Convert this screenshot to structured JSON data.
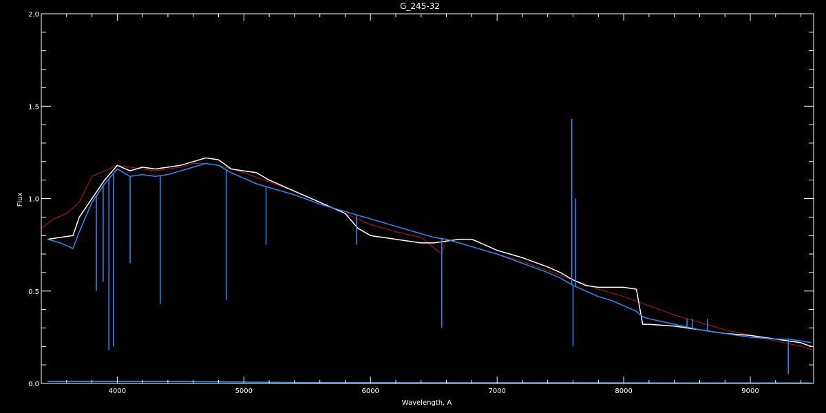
{
  "chart_data": {
    "type": "line",
    "title": "G_245-32",
    "xlabel": "Wavelength, A",
    "ylabel": "Flux",
    "xlim": [
      3400,
      9500
    ],
    "ylim": [
      0.0,
      2.0
    ],
    "x_ticks": [
      4000,
      5000,
      6000,
      7000,
      8000,
      9000
    ],
    "x_tick_labels": [
      "4000",
      "5000",
      "6000",
      "7000",
      "8000",
      "9000"
    ],
    "y_ticks": [
      0.0,
      0.5,
      1.0,
      1.5,
      2.0
    ],
    "y_tick_labels": [
      "0.0",
      "0.5",
      "1.0",
      "1.5",
      "2.0"
    ],
    "grid": false,
    "legend": "none",
    "colors": {
      "background": "#000000",
      "axes": "#ffffff",
      "observed": "#ffffff",
      "calibrated": "#1e90ff",
      "model": "#cc1111",
      "error": "#1e90ff"
    },
    "series": [
      {
        "color": "#cc1111",
        "x": [
          3400,
          3500,
          3600,
          3700,
          3800,
          3900,
          4000,
          4100,
          4200,
          4300,
          4400,
          4500,
          4600,
          4700,
          4800,
          4900,
          5000,
          5200,
          5400,
          5600,
          5800,
          6000,
          6200,
          6400,
          6562,
          6600,
          6800,
          7000,
          7200,
          7400,
          7600,
          7800,
          8000,
          8200,
          8400,
          8600,
          8800,
          9000,
          9200,
          9400,
          9500
        ],
        "y": [
          0.84,
          0.89,
          0.92,
          0.98,
          1.12,
          1.15,
          1.18,
          1.17,
          1.16,
          1.15,
          1.16,
          1.17,
          1.19,
          1.19,
          1.18,
          1.16,
          1.14,
          1.09,
          1.04,
          0.98,
          0.92,
          0.86,
          0.82,
          0.79,
          0.7,
          0.78,
          0.74,
          0.7,
          0.66,
          0.61,
          0.56,
          0.51,
          0.47,
          0.42,
          0.37,
          0.33,
          0.29,
          0.26,
          0.23,
          0.2,
          0.18
        ]
      },
      {
        "color": "#ffffff",
        "x": [
          3450,
          3550,
          3650,
          3700,
          3800,
          3900,
          4000,
          4100,
          4200,
          4300,
          4400,
          4500,
          4600,
          4700,
          4800,
          4900,
          5000,
          5100,
          5200,
          5400,
          5600,
          5800,
          5900,
          6000,
          6200,
          6400,
          6500,
          6600,
          6700,
          6800,
          6900,
          7000,
          7200,
          7400,
          7500,
          7600,
          7700,
          7800,
          7900,
          8000,
          8100,
          8150,
          8200,
          8400,
          8600,
          8800,
          9000,
          9200,
          9400,
          9480
        ],
        "y": [
          0.78,
          0.79,
          0.8,
          0.9,
          1.0,
          1.1,
          1.18,
          1.15,
          1.17,
          1.16,
          1.17,
          1.18,
          1.2,
          1.22,
          1.21,
          1.16,
          1.15,
          1.14,
          1.1,
          1.04,
          0.98,
          0.92,
          0.84,
          0.8,
          0.78,
          0.76,
          0.76,
          0.77,
          0.78,
          0.78,
          0.75,
          0.72,
          0.68,
          0.63,
          0.6,
          0.56,
          0.53,
          0.52,
          0.52,
          0.52,
          0.51,
          0.32,
          0.32,
          0.31,
          0.29,
          0.27,
          0.26,
          0.24,
          0.22,
          0.2
        ]
      },
      {
        "color": "#1e90ff",
        "x": [
          3450,
          3550,
          3650,
          3700,
          3800,
          3900,
          4000,
          4100,
          4200,
          4300,
          4400,
          4500,
          4600,
          4700,
          4800,
          4900,
          5000,
          5100,
          5200,
          5400,
          5600,
          5800,
          6000,
          6200,
          6400,
          6500,
          6600,
          6700,
          6800,
          6900,
          7000,
          7200,
          7400,
          7500,
          7600,
          7700,
          7800,
          7900,
          8000,
          8100,
          8150,
          8200,
          8400,
          8600,
          8800,
          9000,
          9200,
          9300,
          9400,
          9480
        ],
        "y": [
          0.78,
          0.76,
          0.73,
          0.82,
          0.98,
          1.08,
          1.16,
          1.12,
          1.13,
          1.12,
          1.13,
          1.15,
          1.17,
          1.19,
          1.18,
          1.14,
          1.11,
          1.08,
          1.06,
          1.02,
          0.97,
          0.93,
          0.89,
          0.85,
          0.81,
          0.79,
          0.78,
          0.76,
          0.74,
          0.72,
          0.7,
          0.65,
          0.6,
          0.57,
          0.53,
          0.5,
          0.47,
          0.45,
          0.42,
          0.39,
          0.36,
          0.35,
          0.32,
          0.29,
          0.27,
          0.25,
          0.24,
          0.24,
          0.23,
          0.22
        ]
      },
      {
        "color": "#1e90ff",
        "x": [
          3450,
          4500,
          5500,
          6500,
          7500,
          8500,
          9480
        ],
        "y": [
          0.01,
          0.01,
          0.005,
          0.004,
          0.004,
          0.003,
          0.003
        ]
      }
    ],
    "absorption_lines": {
      "x": [
        3835,
        3889,
        3934,
        3970,
        4102,
        4340,
        4861,
        5175,
        5890,
        6563,
        7600,
        8500,
        8542,
        8662,
        9300
      ],
      "depth_y": [
        0.5,
        0.55,
        0.18,
        0.2,
        0.65,
        0.43,
        0.45,
        0.75,
        0.75,
        0.3,
        0.2,
        0.35,
        0.35,
        0.35,
        0.05
      ]
    },
    "emission_lines": {
      "x": [
        7590,
        7620
      ],
      "peak_y": [
        1.43,
        1.0
      ]
    }
  }
}
